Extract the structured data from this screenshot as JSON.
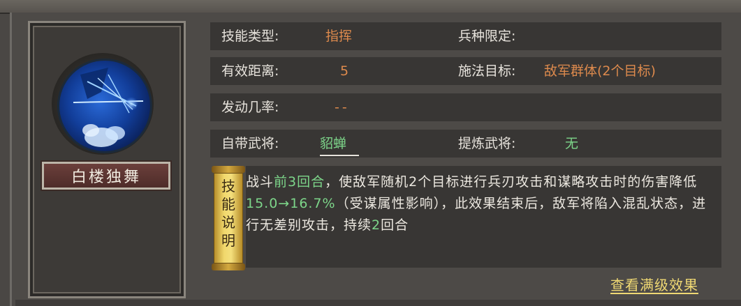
{
  "skill": {
    "name": "白楼独舞"
  },
  "info": {
    "type_label": "技能类型:",
    "type_value": "指挥",
    "troop_label": "兵种限定:",
    "range_label": "有效距离:",
    "range_value": "5",
    "target_label": "施法目标:",
    "target_value": "敌军群体(2个目标)",
    "chance_label": "发动几率:",
    "chance_value": "--",
    "own_general_label": "自带武将:",
    "own_general_value": "貂蝉",
    "refine_label": "提炼武将:",
    "refine_value": "无"
  },
  "description": {
    "scroll_label_chars": [
      "技",
      "能",
      "说",
      "明"
    ],
    "part1": "战斗",
    "hl1": "前3回合",
    "part2": "，使敌军随机2个目标进行兵刃攻击和谋略攻击时的伤害降低",
    "hl2": "15.0→16.7%",
    "part3": "（受谋属性影响），此效果结束后，敌军将陷入混乱状态，进行无差别攻击，持续",
    "hl3": "2",
    "part4": "回合"
  },
  "actions": {
    "view_max_label": "查看满级效果"
  },
  "colors": {
    "accent_orange": "#dd8a4d",
    "accent_green": "#7dd68a",
    "link_gold": "#efd873"
  },
  "icons": {
    "skill_icon": "skill-orb-icon",
    "scroll_icon": "scroll-icon"
  }
}
